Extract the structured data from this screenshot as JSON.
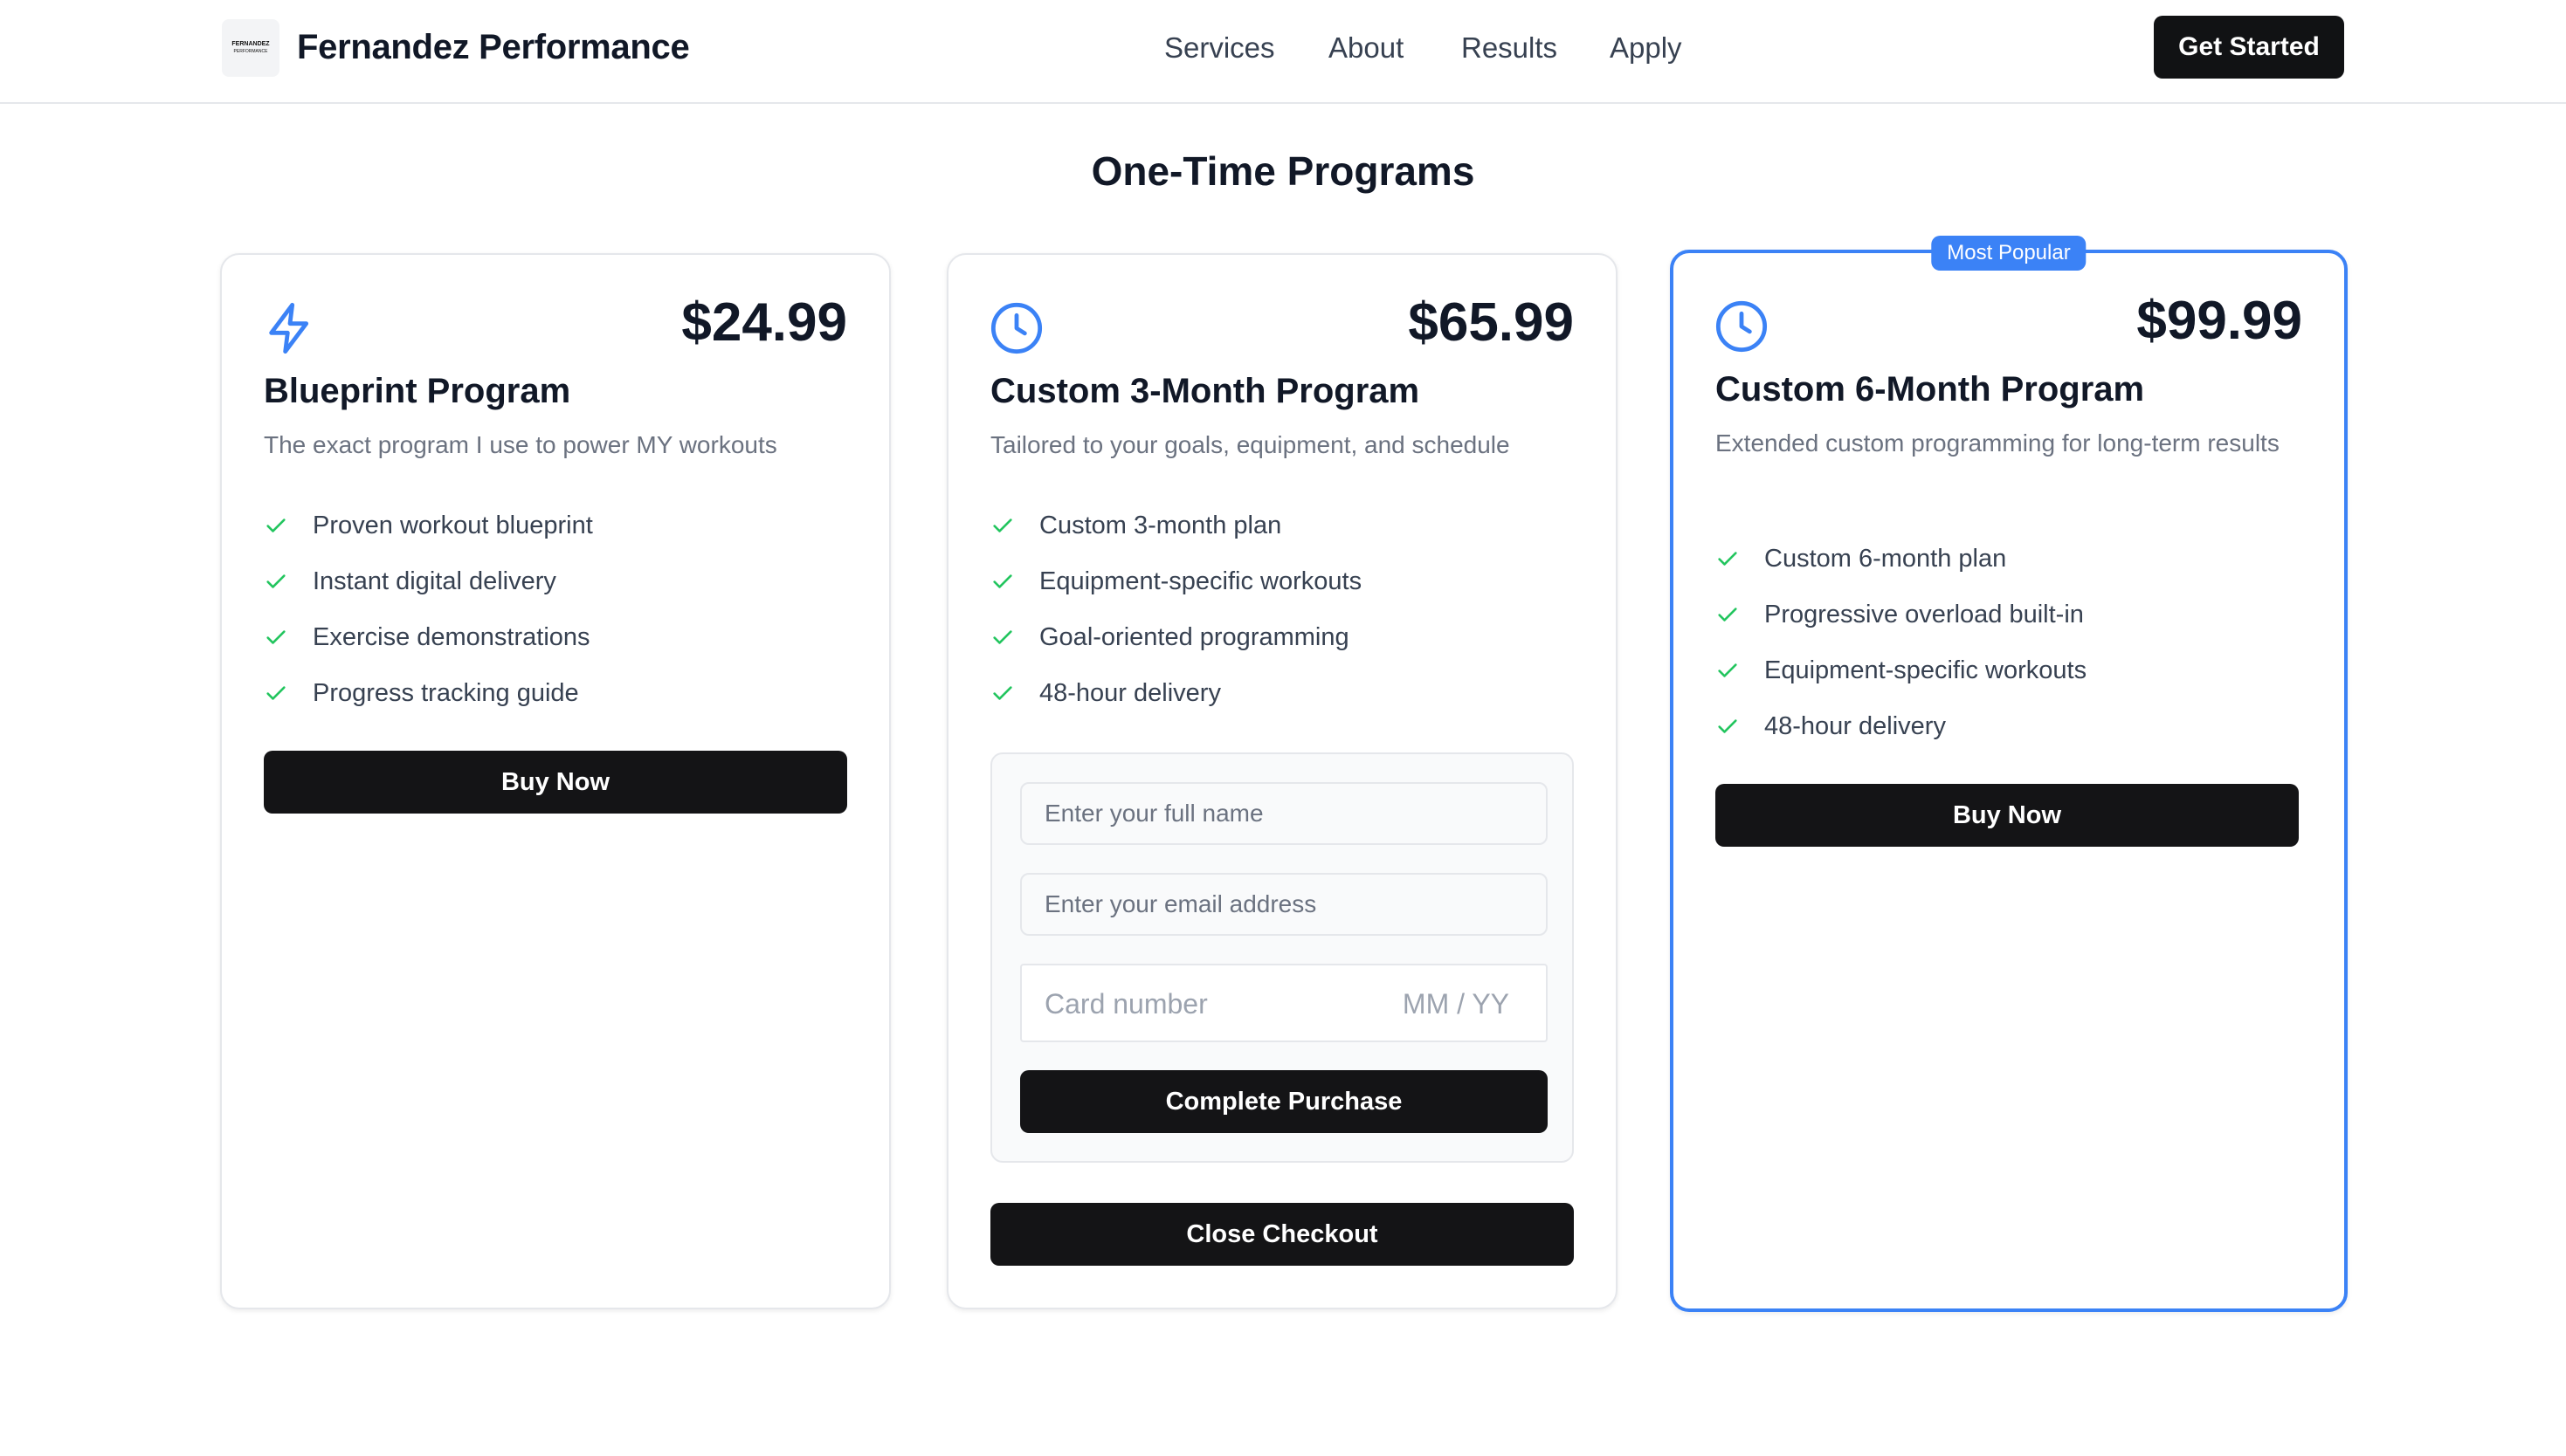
{
  "header": {
    "logo_text": "FERNANDEZ",
    "logo_subtext": "PERFORMANCE",
    "brand": "Fernandez Performance",
    "nav": [
      "Services",
      "About",
      "Results",
      "Apply"
    ],
    "cta": "Get Started"
  },
  "section_title": "One-Time Programs",
  "cards": [
    {
      "icon": "lightning-icon",
      "price": "$24.99",
      "title": "Blueprint Program",
      "description": "The exact program I use to power MY workouts",
      "features": [
        "Proven workout blueprint",
        "Instant digital delivery",
        "Exercise demonstrations",
        "Progress tracking guide"
      ],
      "button": "Buy Now"
    },
    {
      "icon": "clock-icon",
      "price": "$65.99",
      "title": "Custom 3-Month Program",
      "description": "Tailored to your goals, equipment, and schedule",
      "features": [
        "Custom 3-month plan",
        "Equipment-specific workouts",
        "Goal-oriented programming",
        "48-hour delivery"
      ],
      "checkout": {
        "name_placeholder": "Enter your full name",
        "email_placeholder": "Enter your email address",
        "card_placeholder": "Card number",
        "expiry_placeholder": "MM / YY",
        "submit": "Complete Purchase"
      },
      "close_button": "Close Checkout"
    },
    {
      "icon": "clock-icon",
      "badge": "Most Popular",
      "price": "$99.99",
      "title": "Custom 6-Month Program",
      "description": "Extended custom programming for long-term results",
      "features": [
        "Custom 6-month plan",
        "Progressive overload built-in",
        "Equipment-specific workouts",
        "48-hour delivery"
      ],
      "button": "Buy Now"
    }
  ],
  "colors": {
    "accent": "#3b82f6",
    "check": "#22c55e",
    "button": "#141416",
    "text": "#111827",
    "muted": "#6b7280"
  }
}
